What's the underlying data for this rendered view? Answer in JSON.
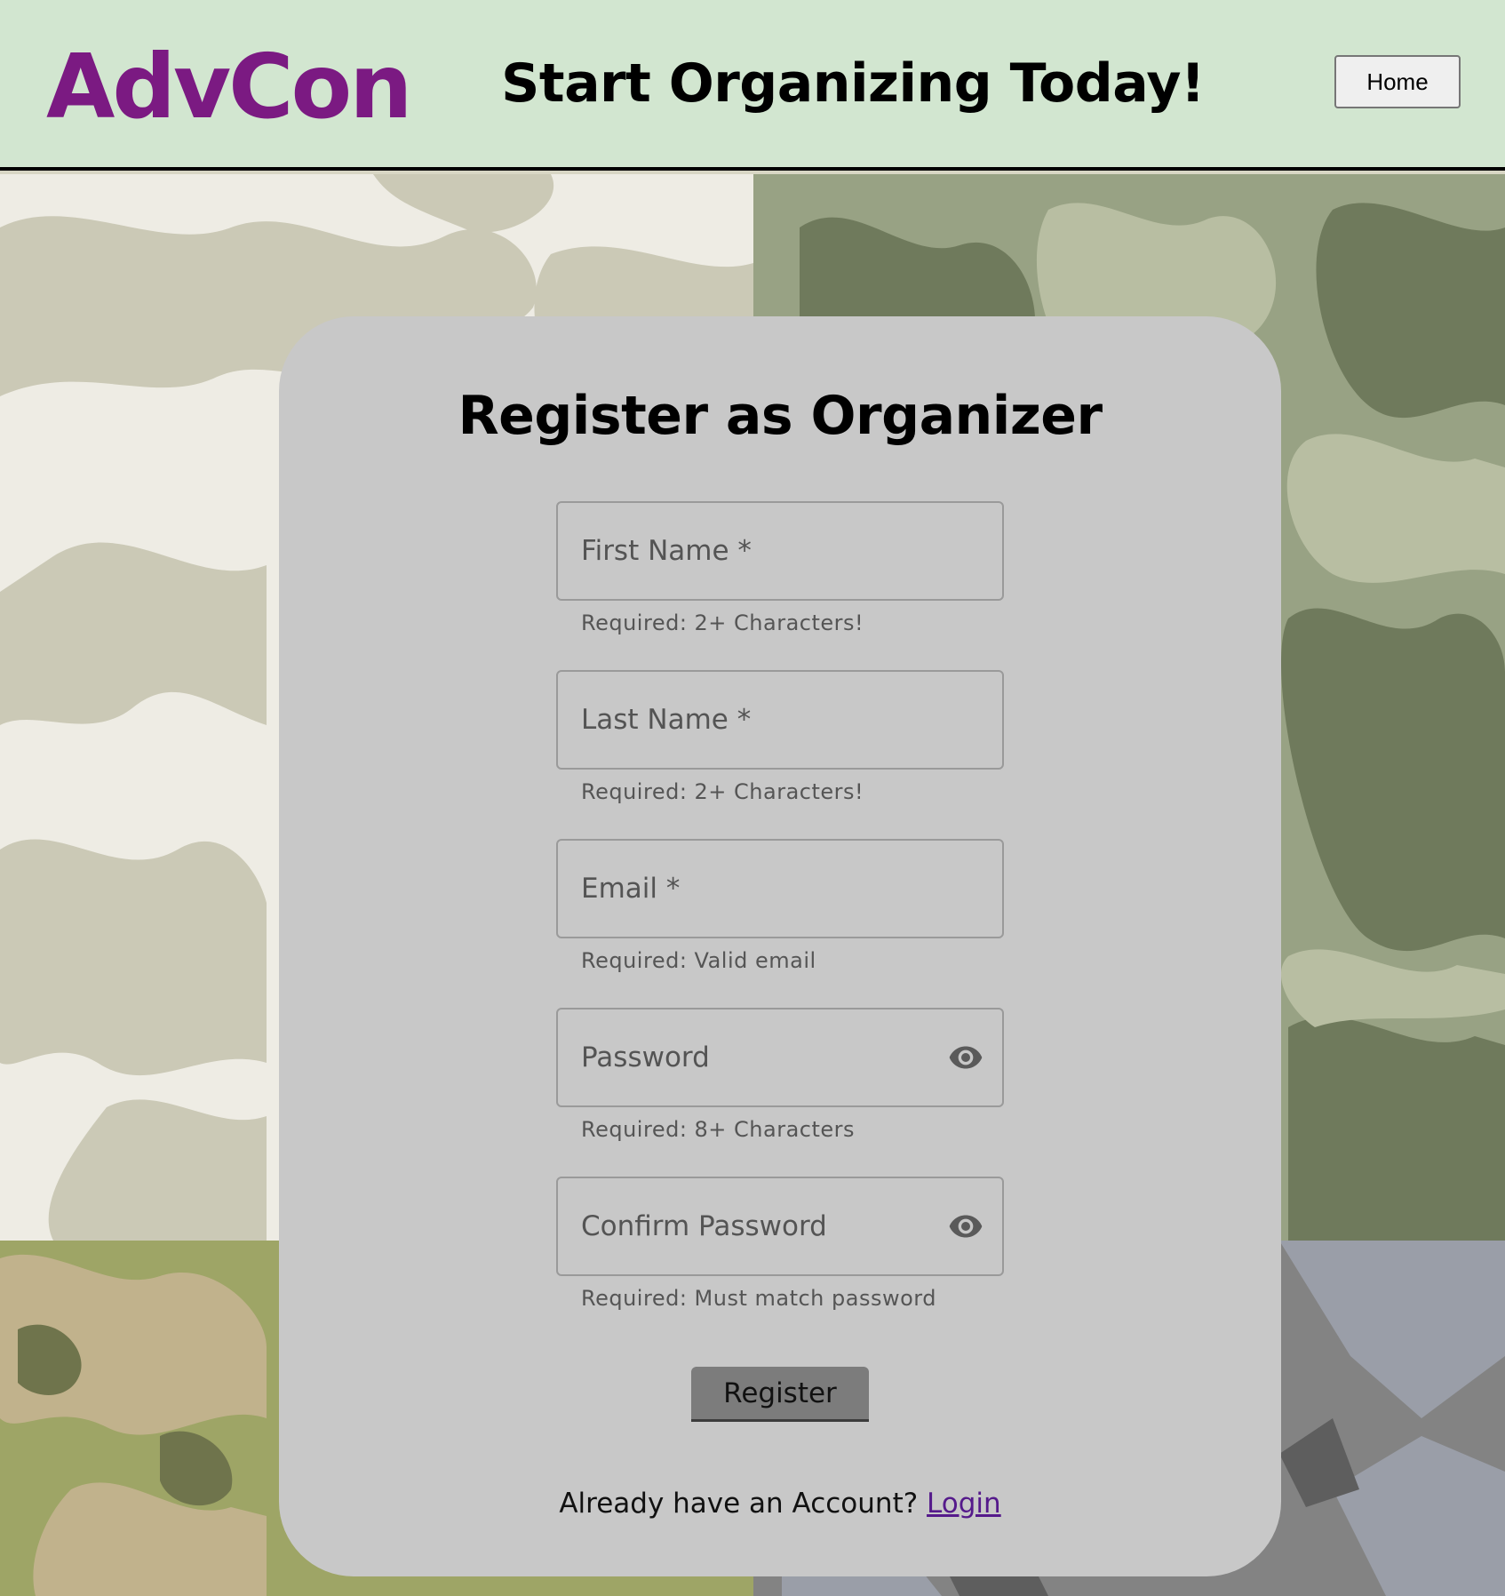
{
  "header": {
    "brand": "AdvCon",
    "tagline": "Start Organizing Today!",
    "home_label": "Home"
  },
  "colors": {
    "header_bg": "#d2e6d0",
    "brand": "#7b1a82",
    "card_bg": "#c8c8c8",
    "register_button": "#7c7c7c",
    "link": "#551a8b"
  },
  "form": {
    "title": "Register as Organizer",
    "fields": [
      {
        "label": "First Name *",
        "value": "",
        "helper": "Required: 2+ Characters!"
      },
      {
        "label": "Last Name *",
        "value": "",
        "helper": "Required: 2+ Characters!"
      },
      {
        "label": "Email *",
        "value": "",
        "helper": "Required: Valid email"
      },
      {
        "label": "Password",
        "value": "",
        "helper": "Required: 8+ Characters",
        "icon": "eye-icon"
      },
      {
        "label": "Confirm Password",
        "value": "",
        "helper": "Required: Must match password",
        "icon": "eye-icon"
      }
    ],
    "register_label": "Register",
    "login_prompt": "Already have an Account?",
    "login_link": "Login"
  }
}
